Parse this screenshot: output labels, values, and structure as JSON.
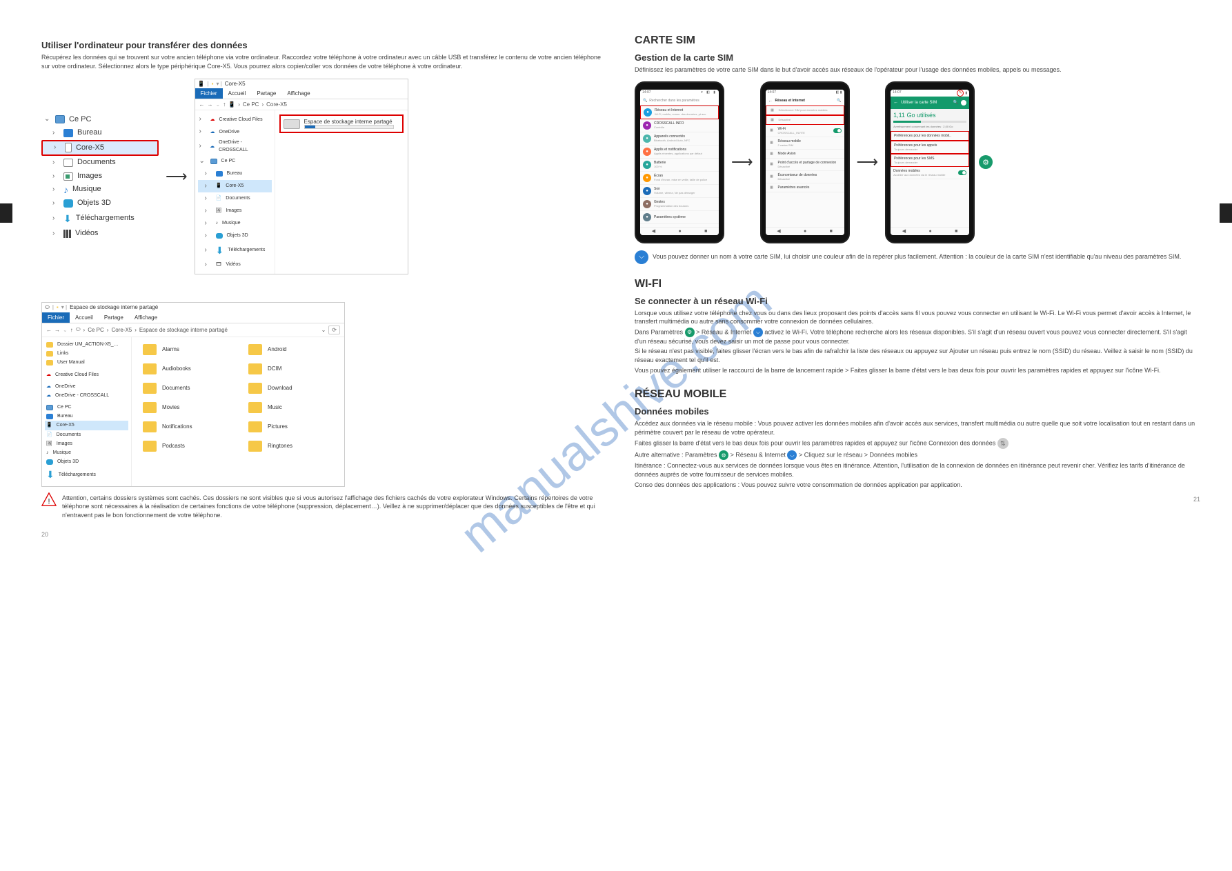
{
  "watermark": "manualshive.com",
  "left_page": {
    "section_title": "Utiliser l'ordinateur pour transférer des données",
    "intro": "Récupérez les données qui se trouvent sur votre ancien téléphone via votre ordinateur. Raccordez votre téléphone à votre ordinateur avec un câble USB et transférez le contenu de votre ancien téléphone sur votre ordinateur. Sélectionnez alors le type périphérique Core-X5. Vous pourrez alors copier/coller vos données de votre téléphone à votre ordinateur.",
    "tree": {
      "root": {
        "label": "Ce PC"
      },
      "items": [
        {
          "label": "Bureau",
          "type": "desktop"
        },
        {
          "label": "Core-X5",
          "type": "phone",
          "selected": true
        },
        {
          "label": "Documents",
          "type": "docs"
        },
        {
          "label": "Images",
          "type": "images"
        },
        {
          "label": "Musique",
          "type": "music"
        },
        {
          "label": "Objets 3D",
          "type": "obj3d"
        },
        {
          "label": "Téléchargements",
          "type": "dl"
        },
        {
          "label": "Vidéos",
          "type": "videos"
        }
      ]
    },
    "win1": {
      "title": "Core-X5",
      "tabs": {
        "active": "Fichier",
        "t2": "Accueil",
        "t3": "Partage",
        "t4": "Affichage"
      },
      "breadcrumb": {
        "a": "Ce PC",
        "b": "Core-X5"
      },
      "nav": [
        "Creative Cloud Files",
        "OneDrive",
        "OneDrive - CROSSCALL",
        "Ce PC",
        "Bureau",
        "Core-X5",
        "Documents",
        "Images",
        "Musique",
        "Objets 3D",
        "Téléchargements",
        "Vidéos"
      ],
      "drive_label": "Espace de stockage interne partagé"
    },
    "win2": {
      "title": "Espace de stockage interne partagé",
      "tabs": {
        "active": "Fichier",
        "t2": "Accueil",
        "t3": "Partage",
        "t4": "Affichage"
      },
      "breadcrumb": {
        "a": "Ce PC",
        "b": "Core-X5",
        "c": "Espace de stockage interne partagé"
      },
      "nav": [
        "Dossier UM_ACTION-X5_…",
        "Links",
        "User Manual",
        "Creative Cloud Files",
        "OneDrive",
        "OneDrive - CROSSCALL",
        "Ce PC",
        "Bureau",
        "Core-X5",
        "Documents",
        "Images",
        "Musique",
        "Objets 3D",
        "Téléchargements"
      ],
      "folders": [
        "Alarms",
        "Android",
        "Audiobooks",
        "DCIM",
        "Documents",
        "Download",
        "Movies",
        "Music",
        "Notifications",
        "Pictures",
        "Podcasts",
        "Ringtones"
      ]
    },
    "warning": "Attention, certains dossiers systèmes sont cachés. Ces dossiers ne sont visibles que si vous autorisez l'affichage des fichiers cachés de votre explorateur Windows. Certains répertoires de votre téléphone sont nécessaires à la réalisation de certaines fonctions de votre téléphone (suppression, déplacement…). Veillez à ne supprimer/déplacer que des données susceptibles de l'être et qui n'entravent pas le bon fonctionnement de votre téléphone."
  },
  "right_page": {
    "title_main": "CARTE SIM",
    "section1": "Gestion de la carte SIM",
    "text1": "Définissez les paramètres de votre carte SIM dans le but d'avoir accès aux réseaux de l'opérateur pour l'usage des données mobiles, appels ou messages.",
    "phone1": {
      "time": "14:07",
      "search": "Rechercher dans les paramètres",
      "rows": [
        {
          "title": "Réseau et Internet",
          "sub": "Wi-Fi, mobile, conso. des données, pt acc.",
          "color": "#1a9fe0",
          "red": true
        },
        {
          "title": "CROSSCALL INFO",
          "sub": "Contrôle",
          "color": "#9c27b0"
        },
        {
          "title": "Appareils connectés",
          "sub": "Bluetooth, Android Auto, NFC",
          "color": "#4db6ac"
        },
        {
          "title": "Applis et notifications",
          "sub": "Applis récentes, applications par défaut",
          "color": "#ff7043"
        },
        {
          "title": "Batterie",
          "sub": "100 %",
          "color": "#26a69a"
        },
        {
          "title": "Écran",
          "sub": "Fond d'écran, mise en veille, taille de police",
          "color": "#ff9800"
        },
        {
          "title": "Son",
          "sub": "Volume, vibreur, Ne pas déranger",
          "color": "#1a6bb8"
        },
        {
          "title": "Gestes",
          "sub": "Programmation des boutons",
          "color": "#8d6e63"
        },
        {
          "title": "Paramètres système",
          "sub": "",
          "color": "#607d8b"
        }
      ]
    },
    "phone2": {
      "header": "Réseau et Internet",
      "rows": [
        {
          "title": "",
          "sub": "Sélectionner SIM pour données mobiles",
          "red": true,
          "icon": "sim"
        },
        {
          "title": "",
          "sub": "Désactivé",
          "red": true,
          "icon": "sim"
        },
        {
          "title": "Wi-Fi",
          "sub": "CROSSCALL_INVITE",
          "icon": "wifi",
          "toggle": true
        },
        {
          "title": "Réseau mobile",
          "sub": "2 cartes SIM",
          "icon": "signal"
        },
        {
          "title": "Mode Avion",
          "sub": "",
          "icon": "plane"
        },
        {
          "title": "Point d'accès et partage de connexion",
          "sub": "Désactivé",
          "icon": "hotspot"
        },
        {
          "title": "Économiseur de données",
          "sub": "Désactivé",
          "icon": "saver"
        },
        {
          "title": "Paramètres avancés",
          "sub": "",
          "icon": "more"
        }
      ]
    },
    "phone3": {
      "header": "Utiliser la carte SIM",
      "pencil": "✎",
      "data": "1,11 Go utilisés",
      "sub_data": "Avertissement concernant les données : 2,00 Go",
      "rows": [
        {
          "title": "Préférences pour les données mobil..",
          "sub": "",
          "red": true
        },
        {
          "title": "Préférences pour les appels",
          "sub": "Toujours demander",
          "red": true
        },
        {
          "title": "Préférences pour les SMS",
          "sub": "Toujours demander",
          "red": true
        },
        {
          "title": "Données mobiles",
          "sub": "Accéder aux données via le réseau mobile",
          "toggle": true
        }
      ]
    },
    "below_phones": "Vous pouvez donner un nom à votre carte SIM, lui choisir une couleur afin de la repérer plus facilement. Attention : la couleur de la carte SIM n'est identifiable qu'au niveau des paramètres SIM.",
    "wifi_section_title": "WI-FI",
    "wifi_conn_title": "Se connecter à un réseau Wi-Fi",
    "wifi_para1": "Lorsque vous utilisez votre téléphone chez vous ou dans des lieux proposant des points d'accès sans fil vous pouvez vous connecter en utilisant le Wi-Fi. Le Wi-Fi vous permet d'avoir accès à Internet, le transfert multimédia ou autre sans consommer votre connexion de données cellulaires.",
    "wifi_para2a": "Dans Paramètres",
    "wifi_para2b": " > Réseau & Internet",
    "wifi_para2c": " activez le Wi-Fi. Votre téléphone recherche alors les réseaux disponibles. S'il s'agit d'un réseau ouvert vous pouvez vous connecter directement. S'il s'agit d'un réseau sécurisé, vous devez saisir un mot de passe pour vous connecter.",
    "wifi_para3": "Si le réseau n'est pas visible, faites glisser l'écran vers le bas afin de rafraîchir la liste des réseaux ou appuyez sur Ajouter un réseau puis entrez le nom (SSID) du réseau. Veillez à saisir le nom (SSID) du réseau exactement tel qu'il est.",
    "wifi_para4": "Vous pouvez également utiliser le raccourci de la barre de lancement rapide > Faites glisser la barre d'état vers le bas deux fois pour ouvrir les paramètres rapides et appuyez sur l'icône Wi-Fi.",
    "mobile_title": "RÉSEAU MOBILE",
    "mobile_sub": "Données mobiles",
    "mobile_p1": "Accédez aux données via le réseau mobile : Vous pouvez activer les données mobiles afin d'avoir accès aux services, transfert multimédia ou autre quelle que soit votre localisation tout en restant dans un périmètre couvert par le réseau de votre opérateur.",
    "mobile_qs": "Faites glisser la barre d'état vers le bas deux fois pour ouvrir les paramètres rapides et appuyez sur l'icône Connexion des données ",
    "mobile_alt": "Autre alternative : Paramètres",
    "mobile_alt2": " > Réseau & Internet",
    "mobile_alt3": " > Cliquez sur le réseau > Données mobiles",
    "mobile_roam": "Itinérance : Connectez-vous aux services de données lorsque vous êtes en itinérance. Attention, l'utilisation de la connexion de données en itinérance peut revenir cher. Vérifiez les tarifs d'itinérance de données auprès de votre fournisseur de services mobiles.",
    "mobile_last": "Conso des données des applications : Vous pouvez suivre votre consommation de données application par application.",
    "colors": {
      "accent": "#1a6bb8",
      "green": "#139a6b",
      "red": "#d00"
    }
  },
  "page_numbers": {
    "left": "20",
    "right": "21"
  }
}
